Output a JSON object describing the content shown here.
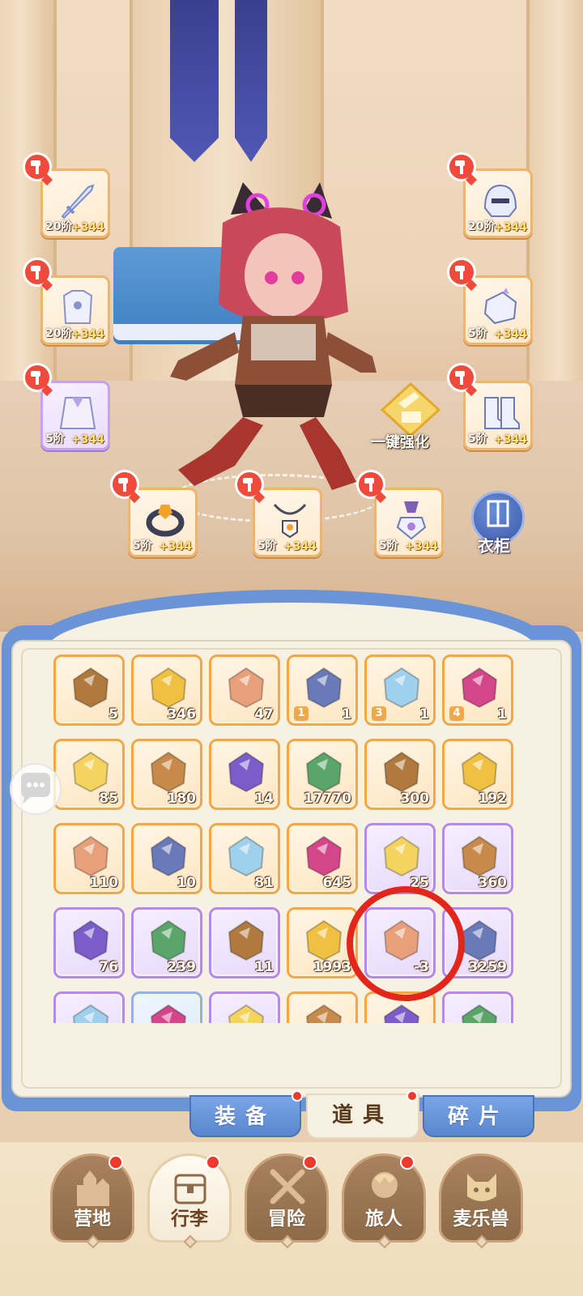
{
  "equipment": [
    {
      "slot": "weapon",
      "tier": "20阶",
      "bonus": "+344",
      "rarity": "orange"
    },
    {
      "slot": "chest",
      "tier": "20阶",
      "bonus": "+344",
      "rarity": "orange"
    },
    {
      "slot": "cloak",
      "tier": "5阶",
      "bonus": "+344",
      "rarity": "purple"
    },
    {
      "slot": "helmet",
      "tier": "20阶",
      "bonus": "+344",
      "rarity": "orange"
    },
    {
      "slot": "gloves",
      "tier": "5阶",
      "bonus": "+344",
      "rarity": "orange"
    },
    {
      "slot": "boots",
      "tier": "5阶",
      "bonus": "+344",
      "rarity": "orange"
    },
    {
      "slot": "ring",
      "tier": "5阶",
      "bonus": "+344",
      "rarity": "orange"
    },
    {
      "slot": "necklace",
      "tier": "5阶",
      "bonus": "+344",
      "rarity": "orange"
    },
    {
      "slot": "amulet",
      "tier": "5阶",
      "bonus": "+344",
      "rarity": "orange"
    }
  ],
  "actions": {
    "one_click_enhance": "一键强化",
    "wardrobe": "衣柜"
  },
  "inventory": {
    "rows": [
      [
        {
          "icon": "log-icon",
          "count": "5",
          "rarity": "orange"
        },
        {
          "icon": "spoon-icon",
          "count": "346",
          "rarity": "orange"
        },
        {
          "icon": "seed-bag-icon",
          "count": "47",
          "rarity": "orange"
        },
        {
          "icon": "stool-icon",
          "count": "1",
          "level": "1",
          "rarity": "orange"
        },
        {
          "icon": "stool-icon",
          "count": "1",
          "level": "3",
          "rarity": "orange"
        },
        {
          "icon": "stool-icon",
          "count": "1",
          "level": "4",
          "rarity": "orange"
        }
      ],
      [
        {
          "icon": "gold-gem-icon",
          "count": "85",
          "rarity": "orange"
        },
        {
          "icon": "star-icon",
          "count": "180",
          "rarity": "orange"
        },
        {
          "icon": "bell-icon",
          "count": "14",
          "rarity": "orange"
        },
        {
          "icon": "orb-icon",
          "count": "17770",
          "rarity": "orange"
        },
        {
          "icon": "lyre-icon",
          "count": "300",
          "rarity": "orange"
        },
        {
          "icon": "crystal-icon",
          "count": "192",
          "rarity": "orange"
        }
      ],
      [
        {
          "icon": "paint-tube-icon",
          "count": "110",
          "rarity": "orange"
        },
        {
          "icon": "paint-splash-icon",
          "count": "10",
          "rarity": "orange"
        },
        {
          "icon": "card-icon",
          "count": "81",
          "rarity": "orange"
        },
        {
          "icon": "jingle-bell-icon",
          "count": "645",
          "rarity": "orange"
        },
        {
          "icon": "horseshoe-icon",
          "count": "25",
          "rarity": "purple"
        },
        {
          "icon": "potion-jar-icon",
          "count": "360",
          "rarity": "purple"
        }
      ],
      [
        {
          "icon": "paw-token-icon",
          "count": "76",
          "rarity": "purple"
        },
        {
          "icon": "cat-spoon-icon",
          "count": "239",
          "rarity": "purple"
        },
        {
          "icon": "paw-bag-icon",
          "count": "11",
          "rarity": "purple"
        },
        {
          "icon": "snowflake-icon",
          "count": "1993",
          "rarity": "orange"
        },
        {
          "icon": "shovel-icon",
          "count": "-3",
          "rarity": "purple"
        },
        {
          "icon": "purple-gem-icon",
          "count": "3259",
          "rarity": "purple"
        }
      ],
      [
        {
          "icon": "egg-icon",
          "count": "",
          "rarity": "purple"
        },
        {
          "icon": "box-icon",
          "count": "",
          "rarity": "blue"
        },
        {
          "icon": "heart-orb-icon",
          "count": "",
          "rarity": "purple"
        },
        {
          "icon": "envelope-icon",
          "count": "",
          "rarity": "orange"
        },
        {
          "icon": "leaf-icon",
          "count": "",
          "rarity": "orange"
        },
        {
          "icon": "bottle-icon",
          "count": "",
          "rarity": "purple"
        }
      ]
    ]
  },
  "bag_tabs": [
    {
      "label": "装备",
      "active": false,
      "badge": true
    },
    {
      "label": "道具",
      "active": true,
      "badge": true
    },
    {
      "label": "碎片",
      "active": false,
      "badge": false
    }
  ],
  "nav": [
    {
      "label": "营地",
      "icon": "castle-icon",
      "badge": true,
      "active": false
    },
    {
      "label": "行李",
      "icon": "chest-icon",
      "badge": true,
      "active": true
    },
    {
      "label": "冒险",
      "icon": "crossed-swords-icon",
      "badge": true,
      "active": false
    },
    {
      "label": "旅人",
      "icon": "traveler-icon",
      "badge": true,
      "active": false
    },
    {
      "label": "麦乐兽",
      "icon": "cat-icon",
      "badge": false,
      "active": false
    }
  ],
  "colors": {
    "orange_frame": "#f0a948",
    "purple_frame": "#b48ae8",
    "panel_blue": "#6a94d6",
    "highlight_red": "#e3261c",
    "badge_red": "#ee3a2c"
  }
}
